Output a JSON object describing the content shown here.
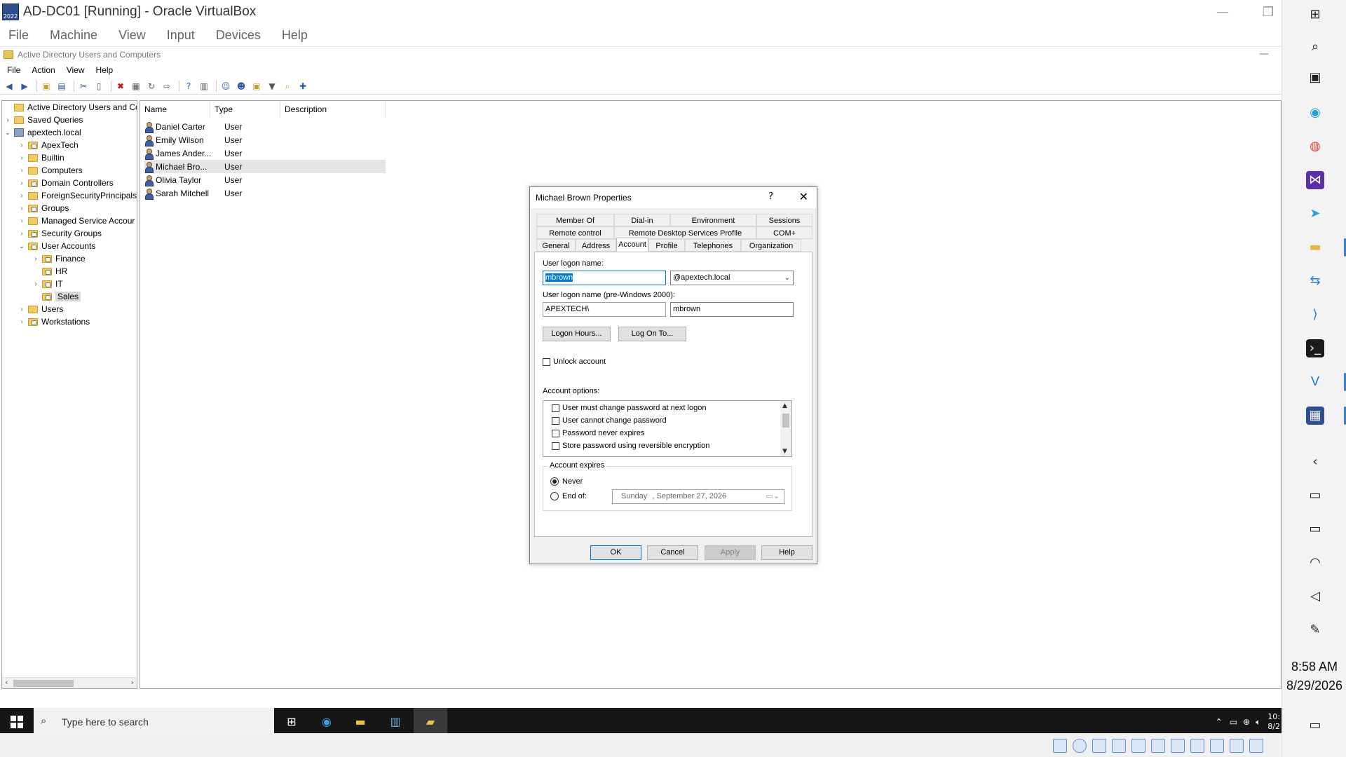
{
  "vbox": {
    "title": "AD-DC01 [Running] - Oracle VirtualBox",
    "menu": [
      "File",
      "Machine",
      "View",
      "Input",
      "Devices",
      "Help"
    ]
  },
  "aduc": {
    "title": "Active Directory Users and Computers",
    "menu": [
      "File",
      "Action",
      "View",
      "Help"
    ],
    "tree": {
      "root": "Active Directory Users and Com",
      "saved_queries": "Saved Queries",
      "domain": "apextech.local",
      "nodes": [
        "ApexTech",
        "Builtin",
        "Computers",
        "Domain Controllers",
        "ForeignSecurityPrincipals",
        "Groups",
        "Managed Service Accour",
        "Security Groups",
        "User Accounts"
      ],
      "user_accounts_children": [
        "Finance",
        "HR",
        "IT",
        "Sales"
      ],
      "after": [
        "Users",
        "Workstations"
      ]
    },
    "list": {
      "columns": [
        "Name",
        "Type",
        "Description"
      ],
      "rows": [
        {
          "name": "Daniel Carter",
          "type": "User"
        },
        {
          "name": "Emily Wilson",
          "type": "User"
        },
        {
          "name": "James Ander...",
          "type": "User"
        },
        {
          "name": "Michael Bro...",
          "type": "User"
        },
        {
          "name": "Olivia Taylor",
          "type": "User"
        },
        {
          "name": "Sarah Mitchell",
          "type": "User"
        }
      ]
    }
  },
  "dialog": {
    "title": "Michael Brown Properties",
    "help_glyph": "?",
    "close_glyph": "✕",
    "tabs_row1": [
      "Member Of",
      "Dial-in",
      "Environment",
      "Sessions"
    ],
    "tabs_row2": [
      "Remote control",
      "Remote Desktop Services Profile",
      "COM+"
    ],
    "tabs_row3": [
      "General",
      "Address",
      "Account",
      "Profile",
      "Telephones",
      "Organization"
    ],
    "logon_label": "User logon name:",
    "logon_value": "mbrown",
    "upn_suffix": "@apextech.local",
    "prewin_label": "User logon name (pre-Windows 2000):",
    "prewin_domain": "APEXTECH\\",
    "prewin_user": "mbrown",
    "logon_hours_btn": "Logon Hours...",
    "logon_to_btn": "Log On To...",
    "unlock_label": "Unlock account",
    "options_label": "Account options:",
    "options": [
      "User must change password at next logon",
      "User cannot change password",
      "Password never expires",
      "Store password using reversible encryption"
    ],
    "expires_legend": "Account expires",
    "never_label": "Never",
    "endof_label": "End of:",
    "end_day": "Sunday",
    "end_date": ", September 27, 2026",
    "ok": "OK",
    "cancel": "Cancel",
    "apply": "Apply",
    "help": "Help"
  },
  "guest_taskbar": {
    "search_placeholder": "Type here to search",
    "tray_time": "10:",
    "tray_date": "8/2"
  },
  "host_clock": {
    "time": "8:58 AM",
    "date": "8/29/2026"
  }
}
